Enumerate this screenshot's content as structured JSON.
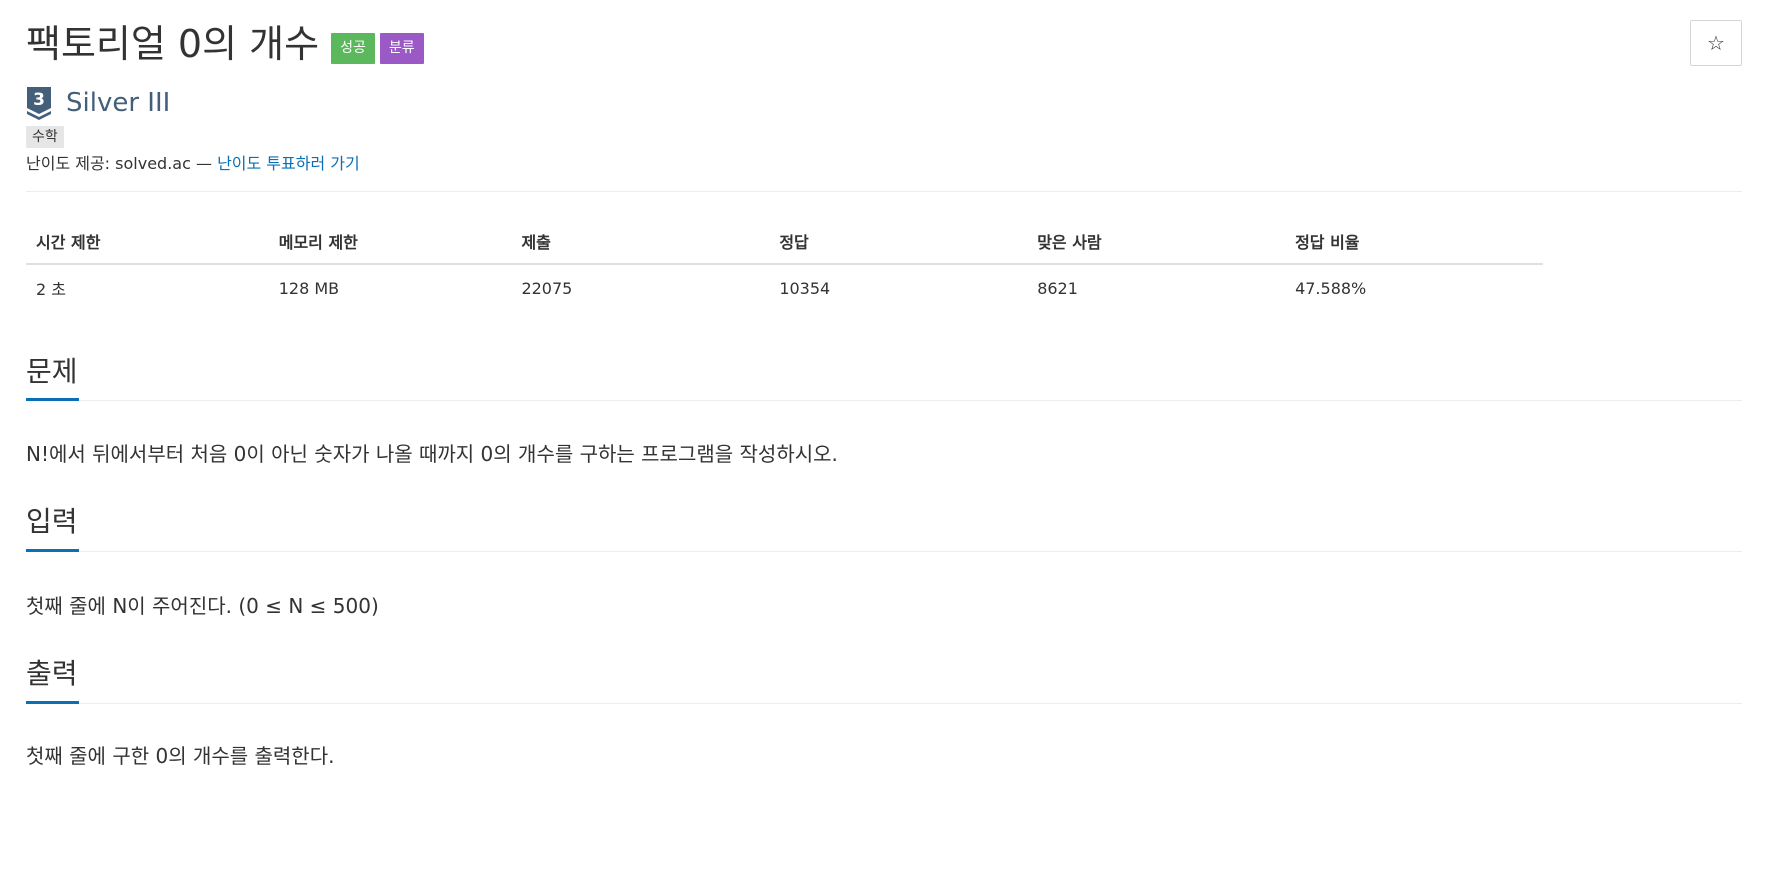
{
  "problem": {
    "title": "팩토리얼 0의 개수",
    "badges": {
      "success": "성공",
      "category": "분류"
    },
    "star_icon": "☆",
    "tier": {
      "level": "3",
      "name": "Silver III"
    },
    "tag": "수학",
    "difficulty_prefix": "난이도 제공: solved.ac — ",
    "vote_link": "난이도 투표하러 가기"
  },
  "stats": {
    "headers": [
      "시간 제한",
      "메모리 제한",
      "제출",
      "정답",
      "맞은 사람",
      "정답 비율"
    ],
    "values": [
      "2 초",
      "128 MB",
      "22075",
      "10354",
      "8621",
      "47.588%"
    ]
  },
  "sections": {
    "problem": {
      "heading": "문제",
      "text": "N!에서 뒤에서부터 처음 0이 아닌 숫자가 나올 때까지 0의 개수를 구하는 프로그램을 작성하시오."
    },
    "input": {
      "heading": "입력",
      "text": "첫째 줄에 N이 주어진다. (0 ≤ N ≤ 500)"
    },
    "output": {
      "heading": "출력",
      "text": "첫째 줄에 구한 0의 개수를 출력한다."
    }
  },
  "colors": {
    "success_badge": "#5cb85c",
    "category_badge": "#9b59c6",
    "link": "#0b6fb5",
    "tier_silver": "#435f7a"
  }
}
